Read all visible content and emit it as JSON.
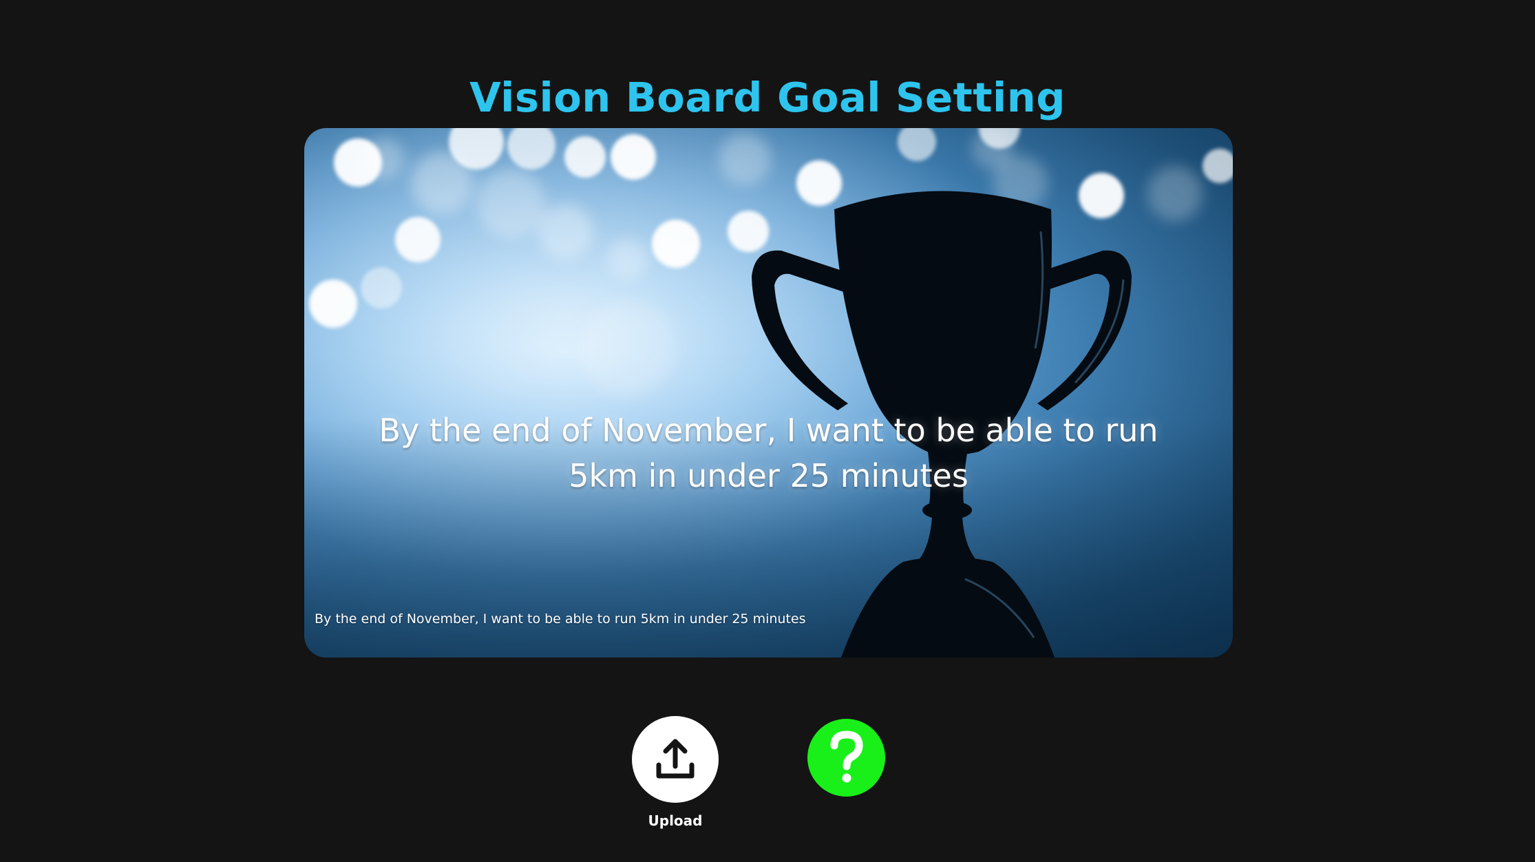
{
  "header": {
    "title": "Vision Board Goal Setting"
  },
  "board": {
    "image_icon": "trophy-silhouette-image",
    "goal_text": "By the end of November, I want to be able to run 5km in under 25 minutes",
    "caption": "By the end of November, I want to be able to run 5km in under 25 minutes"
  },
  "actions": {
    "upload": {
      "icon": "upload-icon",
      "label": "Upload"
    },
    "help": {
      "icon": "question-icon"
    }
  },
  "colors": {
    "background": "#141414",
    "title": "#2ec4ee",
    "help_button": "#19f019",
    "upload_button": "#ffffff"
  }
}
